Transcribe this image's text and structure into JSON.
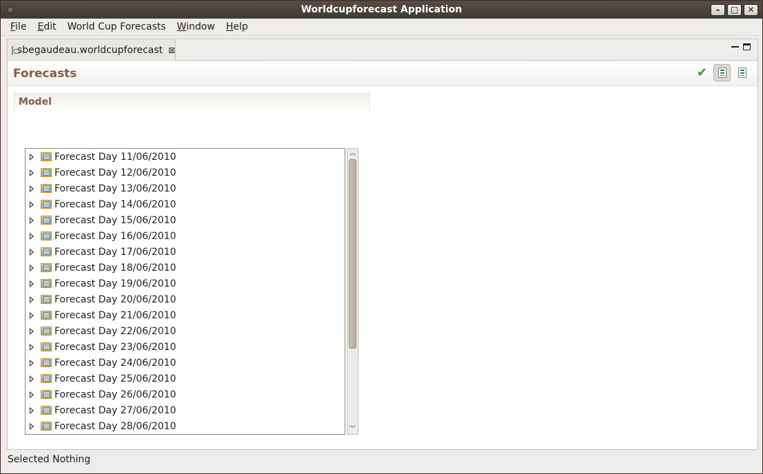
{
  "window": {
    "title": "Worldcupforecast Application",
    "controls": [
      "minimize-icon",
      "maximize-icon",
      "close-icon"
    ]
  },
  "menubar": {
    "items": [
      {
        "label": "File",
        "mnemonic": "F"
      },
      {
        "label": "Edit",
        "mnemonic": "E"
      },
      {
        "label": "World Cup Forecasts",
        "mnemonic": ""
      },
      {
        "label": "Window",
        "mnemonic": "W"
      },
      {
        "label": "Help",
        "mnemonic": "H"
      }
    ]
  },
  "editor": {
    "tab_label": "sbegaudeau.worldcupforecast",
    "tab_close": "⊠"
  },
  "form": {
    "title": "Forecasts",
    "actions": [
      "validate-check-icon",
      "tree-view-icon",
      "list-view-icon"
    ],
    "section_title": "Model",
    "tree_items": [
      "Forecast Day 11/06/2010",
      "Forecast Day 12/06/2010",
      "Forecast Day 13/06/2010",
      "Forecast Day 14/06/2010",
      "Forecast Day 15/06/2010",
      "Forecast Day 16/06/2010",
      "Forecast Day 17/06/2010",
      "Forecast Day 18/06/2010",
      "Forecast Day 19/06/2010",
      "Forecast Day 20/06/2010",
      "Forecast Day 21/06/2010",
      "Forecast Day 22/06/2010",
      "Forecast Day 23/06/2010",
      "Forecast Day 24/06/2010",
      "Forecast Day 25/06/2010",
      "Forecast Day 26/06/2010",
      "Forecast Day 27/06/2010",
      "Forecast Day 28/06/2010"
    ]
  },
  "status": {
    "text": "Selected Nothing"
  },
  "colors": {
    "title_bar": "#3f3934",
    "form_title": "#8b5a3c",
    "accent_check": "#3a9a1a"
  }
}
